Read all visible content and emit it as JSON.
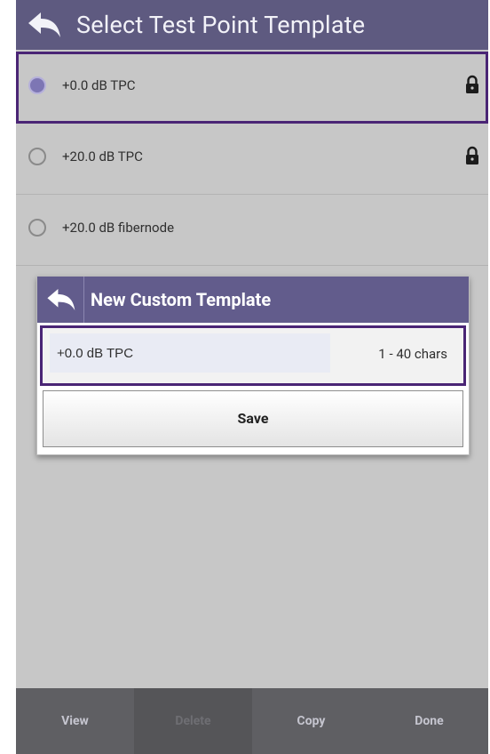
{
  "header": {
    "title": "Select Test Point Template",
    "back_icon": "back-arrow-icon"
  },
  "templates": [
    {
      "label": "+0.0 dB TPC",
      "selected": true,
      "locked": true
    },
    {
      "label": "+20.0 dB TPC",
      "selected": false,
      "locked": true
    },
    {
      "label": "+20.0 dB fibernode",
      "selected": false,
      "locked": false
    }
  ],
  "dialog": {
    "title": "New Custom Template",
    "input_value": "+0.0 dB TPC",
    "hint": "1 - 40 chars",
    "save_label": "Save"
  },
  "toolbar": {
    "view": "View",
    "delete": "Delete",
    "copy": "Copy",
    "done": "Done"
  },
  "colors": {
    "header_bg": "#5e5a80",
    "selection_outline": "#4a2575",
    "dialog_header_bg": "#625c8c",
    "toolbar_bg": "#5f5f63"
  }
}
